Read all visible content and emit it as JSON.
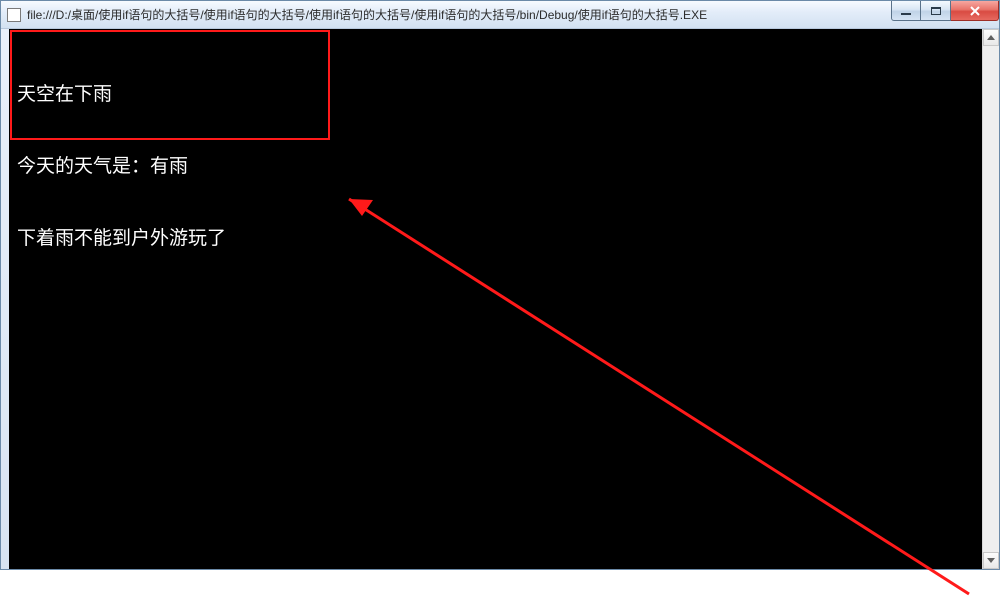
{
  "window": {
    "title": "file:///D:/桌面/使用if语句的大括号/使用if语句的大括号/使用if语句的大括号/使用if语句的大括号/bin/Debug/使用if语句的大括号.EXE"
  },
  "console": {
    "lines": [
      "天空在下雨",
      "今天的天气是：有雨",
      "下着雨不能到户外游玩了"
    ]
  },
  "annotation": {
    "color": "#ff1a1a"
  }
}
